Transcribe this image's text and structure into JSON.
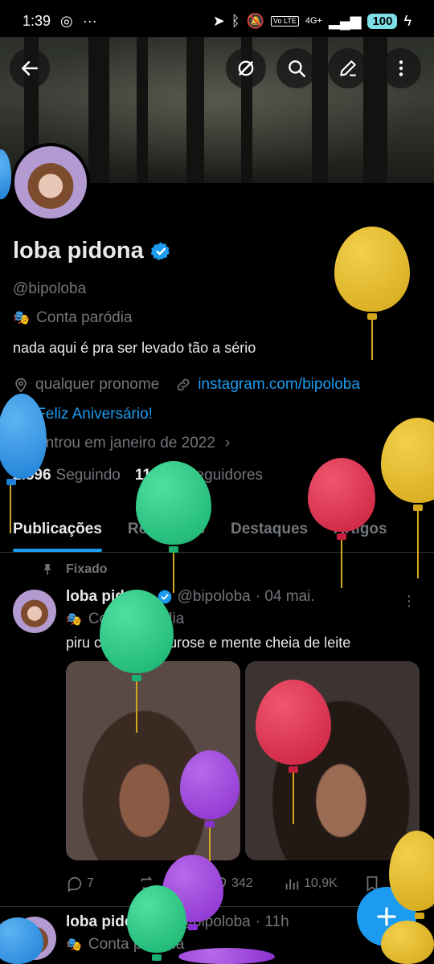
{
  "status": {
    "time": "1:39",
    "battery": "100",
    "net_label": "Vo LTE",
    "signal_label": "4G+"
  },
  "profile": {
    "name": "loba pidona",
    "handle": "@bipoloba",
    "parody_label": "Conta paródia",
    "bio": "nada aqui é pra ser levado tão a sério",
    "pronoun": "qualquer pronome",
    "link": "instagram.com/bipoloba",
    "birthday": "Feliz Aniversário!",
    "joined": "Entrou em janeiro de 2022",
    "following_count": "2.596",
    "following_label": "Seguindo",
    "followers_count": "11.310",
    "followers_label": "Seguidores"
  },
  "tabs": [
    {
      "label": "Publicações"
    },
    {
      "label": "Respostas"
    },
    {
      "label": "Destaques"
    },
    {
      "label": "Artigos"
    }
  ],
  "pinned_label": "Fixado",
  "tweets": [
    {
      "name": "loba pidona",
      "handle": "@bipoloba",
      "time": "· 04 mai.",
      "parody_label": "Conta paródia",
      "text": "piru cheio de neurose e mente cheia de leite",
      "replies": "7",
      "retweets": "",
      "likes": "342",
      "views": "10,9K"
    },
    {
      "name": "loba pidona",
      "handle": "@bipoloba",
      "time": "· 11h",
      "parody_label": "Conta paródia"
    }
  ],
  "icons": {
    "back": "arrow-left-icon",
    "grok": "grok-icon",
    "search": "search-icon",
    "edit": "edit-icon",
    "more": "more-vertical-icon",
    "verified": "verified-badge-icon",
    "parody": "mask-icon",
    "location": "location-icon",
    "link": "link-icon",
    "balloon": "balloon-icon",
    "calendar": "calendar-icon",
    "pin": "pin-icon",
    "reply": "reply-icon",
    "retweet": "retweet-icon",
    "like": "heart-icon",
    "views": "views-icon",
    "bookmark": "bookmark-icon",
    "share": "share-icon",
    "compose": "plus-icon"
  },
  "colors": {
    "accent": "#1d9bf0",
    "muted": "#71767b",
    "text": "#e7e9ea",
    "background": "#000000"
  }
}
